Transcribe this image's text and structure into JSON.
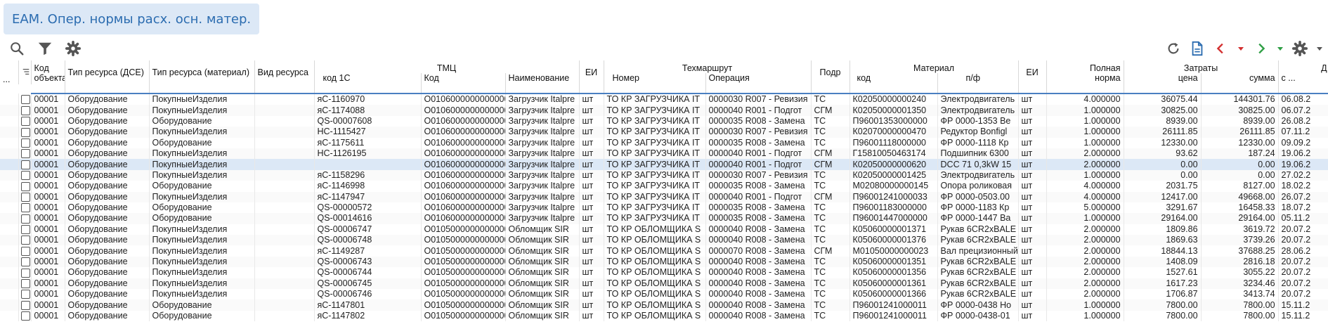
{
  "title": "EAM. Опер. нормы расх. осн. матер.",
  "header": {
    "menu": "...",
    "kod_obj_1": "Код",
    "kod_obj_2": "объекта",
    "tip_dse": "Тип ресурса (ДСЕ)",
    "tip_mat": "Тип ресурса (материал)",
    "vid": "Вид ресурса",
    "tmc": "ТМЦ",
    "kod1c": "код 1С",
    "kod": "Код",
    "naim": "Наименование",
    "ei": "ЕИ",
    "techmarsh": "Техмаршрут",
    "nomer": "Номер",
    "operacia": "Операция",
    "podr": "Подр",
    "material": "Материал",
    "mkod": "код",
    "pf": "п/ф",
    "ei2": "ЕИ",
    "norma_1": "Полная",
    "norma_2": "норма",
    "zatraty": "Затраты",
    "cena": "цена",
    "summa": "сумма",
    "d_1": "Д",
    "d_2": "с ..."
  },
  "rows": [
    [
      "00001",
      "Оборудование",
      "ПокупныеИзделия",
      "",
      "яС-1160970",
      "О0106000000000000",
      "Загрузчик Italpre",
      "шт",
      "ТО КР ЗАГРУЗЧИКА IT",
      "0000030 R007 - Ревизия",
      "ТС",
      "К02050000000240",
      "Электродвигатель",
      "шт",
      "4.000000",
      "36075.44",
      "144301.76",
      "06.08.2"
    ],
    [
      "00001",
      "Оборудование",
      "ПокупныеИзделия",
      "",
      "яС-1174088",
      "О0106000000000000",
      "Загрузчик Italpre",
      "шт",
      "ТО КР ЗАГРУЗЧИКА IT",
      "0000040 R001 - Подгот",
      "СГМ",
      "К02050000001350",
      "Электродвигатель",
      "шт",
      "1.000000",
      "30825.00",
      "30825.00",
      "06.07.2"
    ],
    [
      "00001",
      "Оборудование",
      "Оборудование",
      "",
      "QS-00007608",
      "О0106000000000000",
      "Загрузчик Italpre",
      "шт",
      "ТО КР ЗАГРУЗЧИКА IT",
      "0000035 R008 - Замена",
      "ТС",
      "П96001353000000",
      "ФР 0000-1353 Ве",
      "шт",
      "1.000000",
      "8939.00",
      "8939.00",
      "26.08.2"
    ],
    [
      "00001",
      "Оборудование",
      "ПокупныеИзделия",
      "",
      "НС-1115427",
      "О0106000000000000",
      "Загрузчик Italpre",
      "шт",
      "ТО КР ЗАГРУЗЧИКА IT",
      "0000030 R007 - Ревизия",
      "ТС",
      "К02070000000470",
      "Редуктор Bonfigl",
      "шт",
      "1.000000",
      "26111.85",
      "26111.85",
      "07.11.2"
    ],
    [
      "00001",
      "Оборудование",
      "Оборудование",
      "",
      "яС-1175611",
      "О0106000000000000",
      "Загрузчик Italpre",
      "шт",
      "ТО КР ЗАГРУЗЧИКА IT",
      "0000035 R008 - Замена",
      "ТС",
      "П96001118000000",
      "ФР 0000-1118 Кр",
      "шт",
      "1.000000",
      "12330.00",
      "12330.00",
      "09.09.2"
    ],
    [
      "00001",
      "Оборудование",
      "ПокупныеИзделия",
      "",
      "НС-1126195",
      "О0106000000000000",
      "Загрузчик Italpre",
      "шт",
      "ТО КР ЗАГРУЗЧИКА IT",
      "0000040 R001 - Подгот",
      "СГМ",
      "Г15810050463174",
      "Подшипник 6300",
      "шт",
      "2.000000",
      "93.62",
      "187.24",
      "19.06.2"
    ],
    [
      "00001",
      "Оборудование",
      "ПокупныеИзделия",
      "",
      "",
      "О0106000000000000",
      "Загрузчик Italpre",
      "шт",
      "ТО КР ЗАГРУЗЧИКА IT",
      "0000040 R001 - Подгот",
      "СГМ",
      "К02050000000620",
      "DCC 71 0,3kW 15",
      "шт",
      "2.000000",
      "0.00",
      "0.00",
      "19.06.2"
    ],
    [
      "00001",
      "Оборудование",
      "ПокупныеИзделия",
      "",
      "яС-1158296",
      "О0106000000000000",
      "Загрузчик Italpre",
      "шт",
      "ТО КР ЗАГРУЗЧИКА IT",
      "0000030 R007 - Ревизия",
      "ТС",
      "К02050000001425",
      "Электродвигатель",
      "шт",
      "1.000000",
      "0.00",
      "0.00",
      "27.02.2"
    ],
    [
      "00001",
      "Оборудование",
      "Оборудование",
      "",
      "яС-1146998",
      "О0106000000000000",
      "Загрузчик Italpre",
      "шт",
      "ТО КР ЗАГРУЗЧИКА IT",
      "0000035 R008 - Замена",
      "ТС",
      "М02080000000145",
      "Опора роликовая",
      "шт",
      "4.000000",
      "2031.75",
      "8127.00",
      "18.02.2"
    ],
    [
      "00001",
      "Оборудование",
      "ПокупныеИзделия",
      "",
      "яС-1147947",
      "О0106000000000000",
      "Загрузчик Italpre",
      "шт",
      "ТО КР ЗАГРУЗЧИКА IT",
      "0000040 R001 - Подгот",
      "СГМ",
      "П96001241000033",
      "ФР 0000-0503.00",
      "шт",
      "4.000000",
      "12417.00",
      "49668.00",
      "26.07.2"
    ],
    [
      "00001",
      "Оборудование",
      "Оборудование",
      "",
      "QS-00000572",
      "О0106000000000000",
      "Загрузчик Italpre",
      "шт",
      "ТО КР ЗАГРУЗЧИКА IT",
      "0000035 R008 - Замена",
      "ТС",
      "П96001183000000",
      "ФР 0000-1183 Кр",
      "шт",
      "5.000000",
      "3291.67",
      "16458.33",
      "18.07.2"
    ],
    [
      "00001",
      "Оборудование",
      "Оборудование",
      "",
      "QS-00014616",
      "О0106000000000000",
      "Загрузчик Italpre",
      "шт",
      "ТО КР ЗАГРУЗЧИКА IT",
      "0000035 R008 - Замена",
      "ТС",
      "П96001447000000",
      "ФР 0000-1447 Ва",
      "шт",
      "1.000000",
      "29164.00",
      "29164.00",
      "05.11.2"
    ],
    [
      "00001",
      "Оборудование",
      "ПокупныеИзделия",
      "",
      "QS-00006747",
      "О0105000000000000",
      "Обломщик SIR",
      "шт",
      "ТО КР ОБЛОМЩИКА S",
      "0000040 R008 - Замена",
      "ТС",
      "К05060000001371",
      "Рукав 6CR2xBALE",
      "шт",
      "2.000000",
      "1809.86",
      "3619.72",
      "20.07.2"
    ],
    [
      "00001",
      "Оборудование",
      "ПокупныеИзделия",
      "",
      "QS-00006748",
      "О0105000000000000",
      "Обломщик SIR",
      "шт",
      "ТО КР ОБЛОМЩИКА S",
      "0000040 R008 - Замена",
      "ТС",
      "К05060000001376",
      "Рукав 6CR2xBALE",
      "шт",
      "2.000000",
      "1869.63",
      "3739.26",
      "20.07.2"
    ],
    [
      "00001",
      "Оборудование",
      "ПокупныеИзделия",
      "",
      "яС-1149287",
      "О0105000000000000",
      "Обломщик SIR",
      "шт",
      "ТО КР ОБЛОМЩИКА S",
      "0000070 R008 - Замена",
      "СГМ",
      "М01050000000023",
      "Вал прецизионный",
      "шт",
      "2.000000",
      "18844.13",
      "37688.25",
      "28.06.2"
    ],
    [
      "00001",
      "Оборудование",
      "ПокупныеИзделия",
      "",
      "QS-00006743",
      "О0105000000000000",
      "Обломщик SIR",
      "шт",
      "ТО КР ОБЛОМЩИКА S",
      "0000040 R008 - Замена",
      "ТС",
      "К05060000001351",
      "Рукав 6CR2xBALE",
      "шт",
      "2.000000",
      "1408.09",
      "2816.18",
      "20.07.2"
    ],
    [
      "00001",
      "Оборудование",
      "ПокупныеИзделия",
      "",
      "QS-00006744",
      "О0105000000000000",
      "Обломщик SIR",
      "шт",
      "ТО КР ОБЛОМЩИКА S",
      "0000040 R008 - Замена",
      "ТС",
      "К05060000001356",
      "Рукав 6CR2xBALE",
      "шт",
      "2.000000",
      "1527.61",
      "3055.22",
      "20.07.2"
    ],
    [
      "00001",
      "Оборудование",
      "ПокупныеИзделия",
      "",
      "QS-00006745",
      "О0105000000000000",
      "Обломщик SIR",
      "шт",
      "ТО КР ОБЛОМЩИКА S",
      "0000040 R008 - Замена",
      "ТС",
      "К05060000001361",
      "Рукав 6CR2xBALE",
      "шт",
      "2.000000",
      "1617.23",
      "3234.46",
      "20.07.2"
    ],
    [
      "00001",
      "Оборудование",
      "ПокупныеИзделия",
      "",
      "QS-00006746",
      "О0105000000000000",
      "Обломщик SIR",
      "шт",
      "ТО КР ОБЛОМЩИКА S",
      "0000040 R008 - Замена",
      "ТС",
      "К05060000001366",
      "Рукав 6CR2xBALE",
      "шт",
      "2.000000",
      "1706.87",
      "3413.74",
      "20.07.2"
    ],
    [
      "00001",
      "Оборудование",
      "Оборудование",
      "",
      "яС-1147801",
      "О0105000000000000",
      "Обломщик SIR",
      "шт",
      "ТО КР ОБЛОМЩИКА S",
      "0000040 R008 - Замена",
      "ТС",
      "П96001241000011",
      "ФР 0000-0438 Но",
      "шт",
      "1.000000",
      "7800.00",
      "7800.00",
      "15.11.2"
    ],
    [
      "00001",
      "Оборудование",
      "Оборудование",
      "",
      "яС-1147802",
      "О0105000000000000",
      "Обломщик SIR",
      "шт",
      "ТО КР ОБЛОМЩИКА S",
      "0000040 R008 - Замена",
      "ТС",
      "П96001241000011",
      "ФР 0000-0438-01",
      "шт",
      "1.000000",
      "7800.00",
      "7800.00",
      "15.11.2"
    ]
  ],
  "selected_row": 6,
  "colors": {
    "accent": "#2b6cb0",
    "title_bg": "#dce8f6",
    "selected": "#dce8f6",
    "nav_red": "#d32f2f",
    "nav_green": "#2e9e44"
  },
  "icons": [
    "search-icon",
    "filter-icon",
    "settings-icon",
    "refresh-icon",
    "document-icon",
    "prev-icon",
    "next-icon"
  ]
}
